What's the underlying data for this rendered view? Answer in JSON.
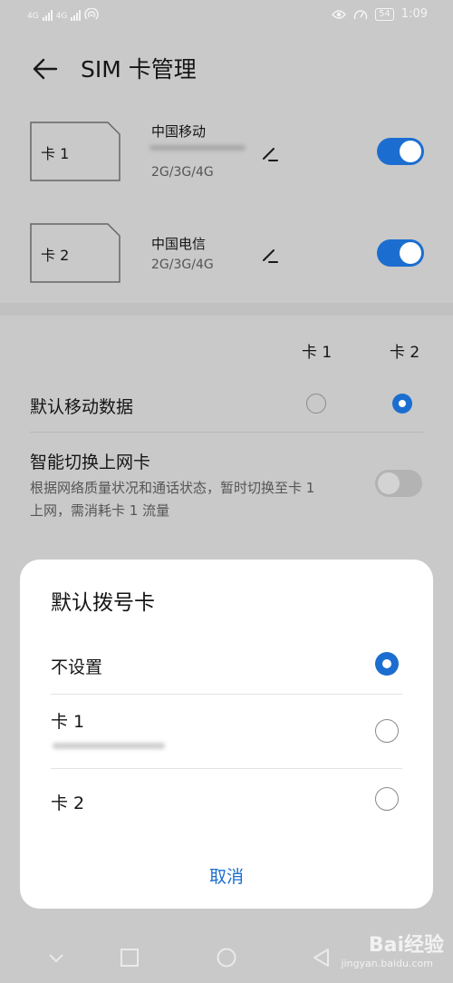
{
  "statusbar": {
    "sig1": "4G",
    "sig2": "4G",
    "battery": "54",
    "time": "1:09"
  },
  "header": {
    "title": "SIM 卡管理"
  },
  "sim_cards": [
    {
      "slot": "卡 1",
      "carrier": "中国移动",
      "network": "2G/3G/4G",
      "enabled": true
    },
    {
      "slot": "卡 2",
      "carrier": "中国电信",
      "network": "2G/3G/4G",
      "enabled": true
    }
  ],
  "settings": {
    "col1": "卡 1",
    "col2": "卡 2",
    "default_data": {
      "label": "默认移动数据",
      "selected": "卡 2"
    },
    "smart_switch": {
      "label": "智能切换上网卡",
      "description": "根据网络质量状况和通话状态，暂时切换至卡 1 上网，需消耗卡 1 流量",
      "enabled": false
    }
  },
  "dialog": {
    "title": "默认拨号卡",
    "options": [
      {
        "label": "不设置",
        "selected": true
      },
      {
        "label": "卡 1",
        "selected": false
      },
      {
        "label": "卡 2",
        "selected": false
      }
    ],
    "cancel": "取消"
  },
  "watermark": {
    "brand": "Bai经验",
    "url": "jingyan.baidu.com"
  },
  "colors": {
    "accent": "#1b6ed0",
    "dim_background": "#c9c9c9"
  }
}
